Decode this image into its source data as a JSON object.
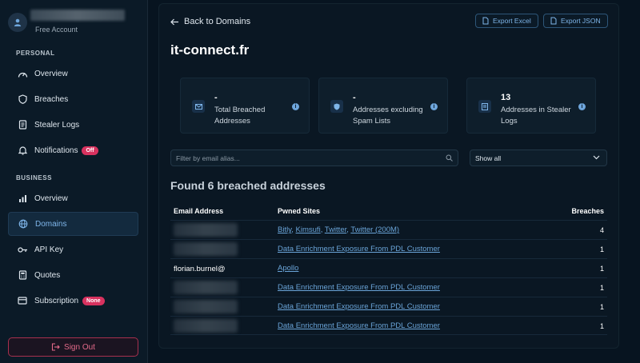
{
  "profile": {
    "account_type": "Free Account"
  },
  "sidebar": {
    "personal_label": "PERSONAL",
    "personal_items": [
      {
        "label": "Overview",
        "icon": "gauge-icon"
      },
      {
        "label": "Breaches",
        "icon": "shield-icon"
      },
      {
        "label": "Stealer Logs",
        "icon": "document-icon"
      },
      {
        "label": "Notifications",
        "icon": "bell-icon",
        "badge": "Off"
      }
    ],
    "business_label": "BUSINESS",
    "business_items": [
      {
        "label": "Overview",
        "icon": "bar-chart-icon"
      },
      {
        "label": "Domains",
        "icon": "globe-icon",
        "active": true
      },
      {
        "label": "API Key",
        "icon": "key-icon"
      },
      {
        "label": "Quotes",
        "icon": "calculator-icon"
      },
      {
        "label": "Subscription",
        "icon": "credit-card-icon",
        "badge": "None"
      }
    ],
    "sign_out": "Sign Out"
  },
  "main": {
    "back_label": "Back to Domains",
    "export_excel": "Export Excel",
    "export_json": "Export JSON",
    "domain": "it-connect.fr",
    "stats": [
      {
        "value": "-",
        "label": "Total Breached Addresses",
        "icon": "mail-icon"
      },
      {
        "value": "-",
        "label": "Addresses excluding Spam Lists",
        "icon": "shield-icon"
      },
      {
        "value": "13",
        "label": "Addresses in Stealer Logs",
        "icon": "document-icon"
      }
    ],
    "filter_placeholder": "Filter by email alias...",
    "filter_select": "Show all",
    "found_text": "Found 6 breached addresses",
    "table": {
      "headers": [
        "Email Address",
        "Pwned Sites",
        "Breaches"
      ],
      "rows": [
        {
          "email": "",
          "sites": [
            "Bitly",
            "Kimsufi",
            "Twitter",
            "Twitter (200M)"
          ],
          "breaches": "4"
        },
        {
          "email": "",
          "sites": [
            "Data Enrichment Exposure From PDL Customer"
          ],
          "breaches": "1"
        },
        {
          "email": "florian.burnel@",
          "sites": [
            "Apollo"
          ],
          "breaches": "1"
        },
        {
          "email": "",
          "sites": [
            "Data Enrichment Exposure From PDL Customer"
          ],
          "breaches": "1"
        },
        {
          "email": "",
          "sites": [
            "Data Enrichment Exposure From PDL Customer"
          ],
          "breaches": "1"
        },
        {
          "email": "",
          "sites": [
            "Data Enrichment Exposure From PDL Customer"
          ],
          "breaches": "1"
        }
      ]
    }
  },
  "colors": {
    "accent": "#6aa4d8",
    "danger": "#d8325f",
    "background": "#071420"
  }
}
